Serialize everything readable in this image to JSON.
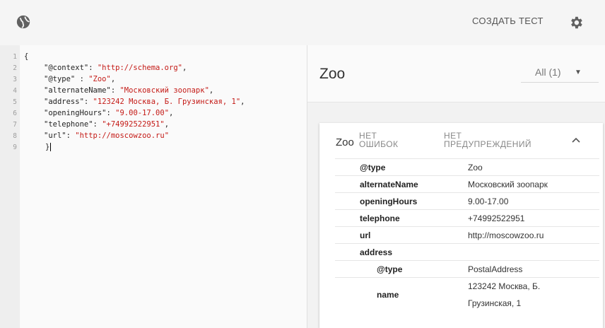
{
  "toolbar": {
    "globe_icon": "globe-icon",
    "create_test_label": "СОЗДАТЬ ТЕСТ",
    "settings_icon": "gear-icon"
  },
  "editor": {
    "line_numbers": [
      "1",
      "2",
      "3",
      "4",
      "5",
      "6",
      "7",
      "8",
      "9"
    ],
    "lines": [
      {
        "key": "{",
        "value": ""
      },
      {
        "key": "\"@context\": ",
        "value": "\"http://schema.org\"",
        "tail": ","
      },
      {
        "key": "\"@type\" : ",
        "value": "\"Zoo\"",
        "tail": ","
      },
      {
        "key": "\"alternateName\": ",
        "value": "\"Московский зоопарк\"",
        "tail": ","
      },
      {
        "key": "\"address\": ",
        "value": "\"123242 Москва, Б. Грузинская, 1\"",
        "tail": ","
      },
      {
        "key": "\"openingHours\": ",
        "value": "\"9.00-17.00\"",
        "tail": ","
      },
      {
        "key": "\"telephone\": ",
        "value": "\"+74992522951\"",
        "tail": ","
      },
      {
        "key": "\"url\": ",
        "value": "\"http://moscowzoo.ru\"",
        "tail": ""
      },
      {
        "key": "}",
        "value": ""
      }
    ]
  },
  "result": {
    "title": "Zoo",
    "filter_label": "All (1)",
    "card": {
      "type": "Zoo",
      "errors_line1": "НЕТ",
      "errors_line2": "ОШИБОК",
      "warnings_line1": "НЕТ",
      "warnings_line2": "ПРЕДУПРЕЖДЕНИЙ",
      "rows": [
        {
          "key": "@type",
          "value": "Zoo"
        },
        {
          "key": "alternateName",
          "value": "Московский зоопарк"
        },
        {
          "key": "openingHours",
          "value": "9.00-17.00"
        },
        {
          "key": "telephone",
          "value": "+74992522951"
        },
        {
          "key": "url",
          "value": "http://moscowzoo.ru"
        },
        {
          "key": "address",
          "value": ""
        },
        {
          "key": "@type",
          "value": "PostalAddress"
        },
        {
          "key": "name",
          "value_line1": "123242 Москва, Б.",
          "value_line2": "Грузинская, 1"
        }
      ]
    }
  }
}
